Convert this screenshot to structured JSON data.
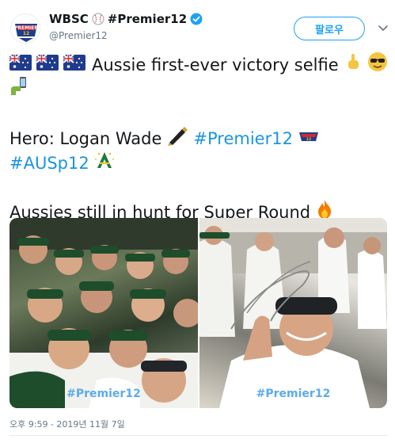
{
  "header": {
    "display_name": "WBSC",
    "name_suffix": "#Premier12",
    "handle": "@Premier12",
    "follow_label": "팔로우"
  },
  "tweet": {
    "line1": "Aussie first-ever victory selfie",
    "line3_prefix": "Hero: Logan Wade",
    "hashtag_premier12": "#Premier12",
    "hashtag_ausp12": "#AUSp12",
    "line5": "Aussies still in hunt for Super Round"
  },
  "media": {
    "left_watermark": "#Premier12",
    "right_watermark": "#Premier12"
  },
  "timestamp": "오후 9:59 - 2019년 11월 7일",
  "colors": {
    "link": "#1b95e0",
    "follow_border": "#1da1f2",
    "secondary_text": "#657786",
    "team_green": "#1e4d2b",
    "team_gold": "#f2c230"
  },
  "icons": [
    "wbsc-premier12-logo",
    "baseball-icon",
    "verified-badge-icon",
    "chevron-down-icon",
    "australia-flag-icon",
    "pointing-up-icon",
    "sunglasses-face-icon",
    "selfie-hand-icon",
    "pen-icon",
    "premier12-logo-icon",
    "aus-team-logo-icon",
    "fire-icon"
  ]
}
